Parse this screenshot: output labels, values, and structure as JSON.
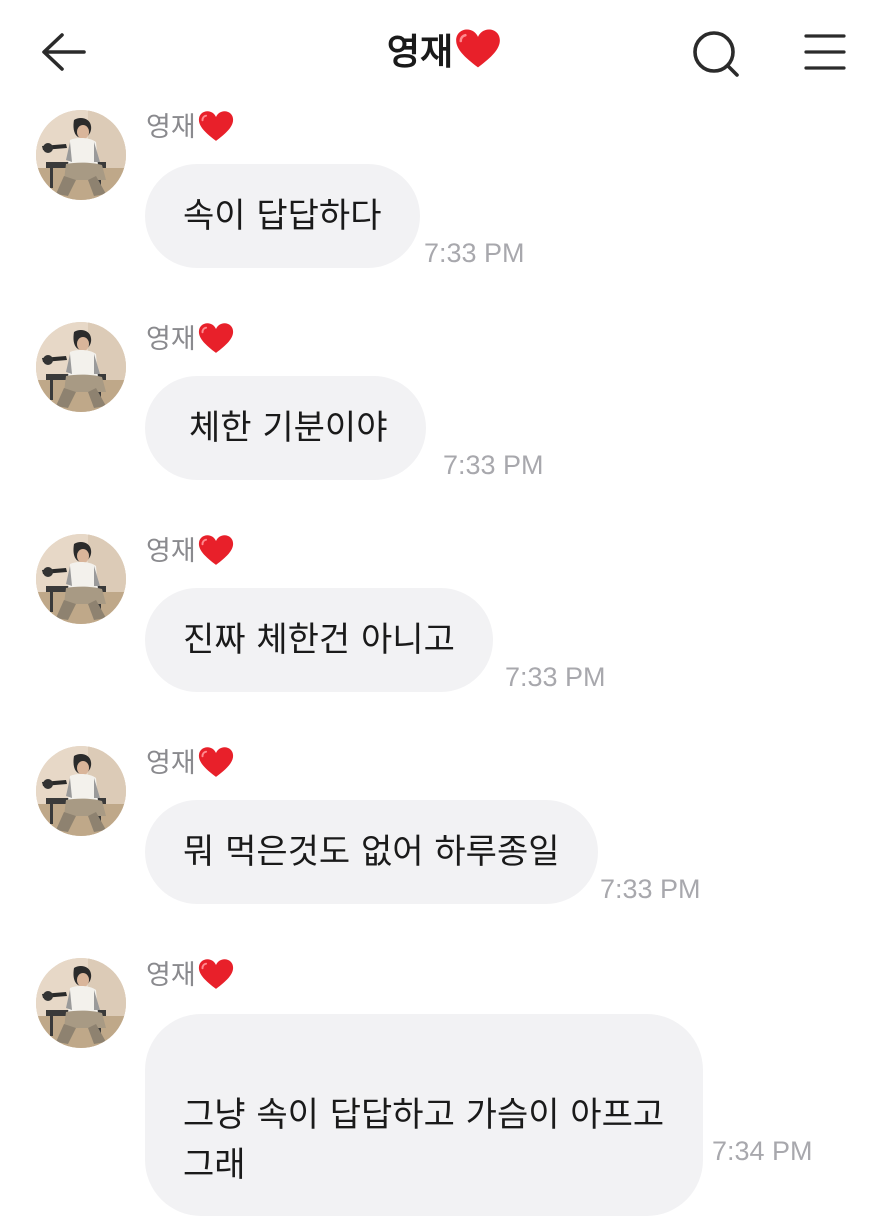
{
  "header": {
    "title": "영재",
    "back_icon": "back-arrow-icon",
    "search_icon": "search-icon",
    "menu_icon": "hamburger-menu-icon"
  },
  "colors": {
    "bubble": "#f2f2f4",
    "heart": "#e8202a",
    "timestamp": "#a8a8ad",
    "sender": "#8a8a8e"
  },
  "messages": [
    {
      "sender": "영재",
      "text": "속이 답답하다",
      "time": "7:33 PM"
    },
    {
      "sender": "영재",
      "text": "체한 기분이야",
      "time": "7:33 PM"
    },
    {
      "sender": "영재",
      "text": "진짜 체한건 아니고",
      "time": "7:33 PM"
    },
    {
      "sender": "영재",
      "text": "뭐 먹은것도 없어 하루종일",
      "time": "7:33 PM"
    },
    {
      "sender": "영재",
      "text": "그냥 속이 답답하고 가슴이 아프고\n그래",
      "time": "7:34 PM"
    }
  ]
}
